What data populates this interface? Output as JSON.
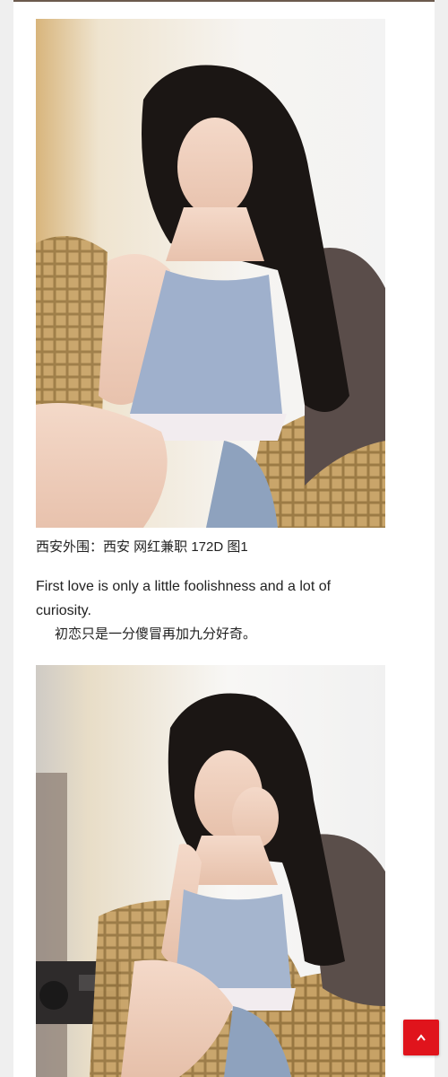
{
  "colors": {
    "accent": "#e0141c",
    "card_bg": "#ffffff",
    "page_bg": "#efefef",
    "text": "#222222"
  },
  "post": {
    "caption": "西安外围：西安 网红兼职 172D 图1",
    "quote_en": "First love is only a little foolishness and a lot of curiosity.",
    "quote_cn": "初恋只是一分傻冒再加九分好奇。"
  },
  "images": [
    {
      "name": "photo-1",
      "description": ""
    },
    {
      "name": "photo-2",
      "description": ""
    }
  ],
  "ui": {
    "scroll_top_icon": "chevron-up-icon"
  }
}
